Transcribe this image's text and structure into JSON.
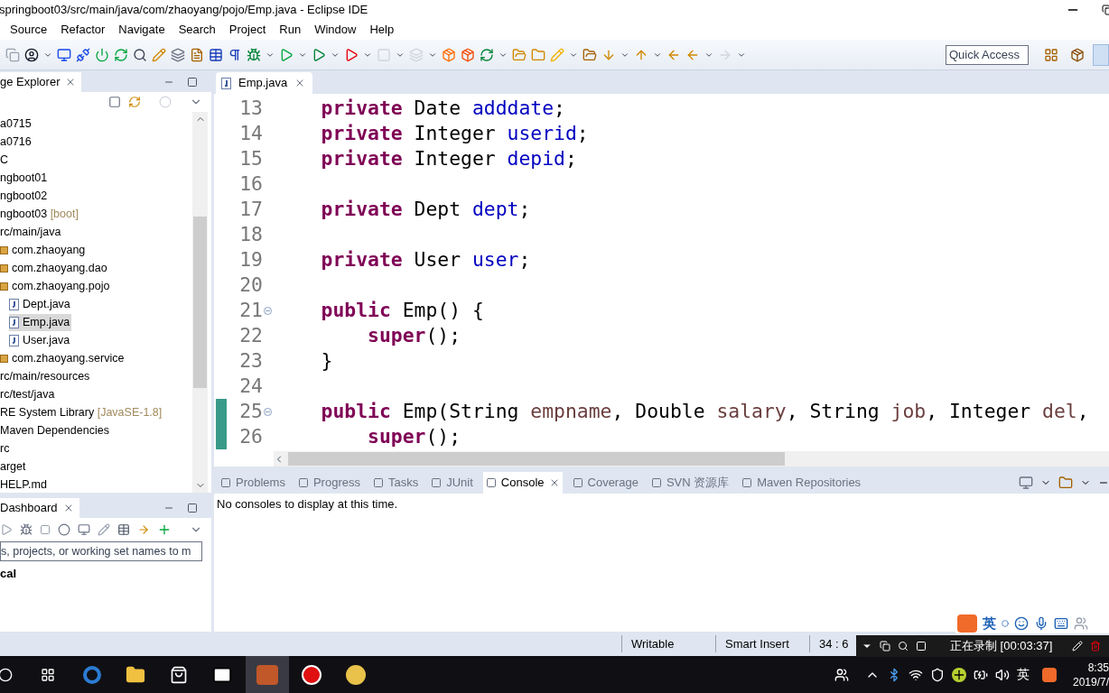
{
  "window": {
    "title": "springboot03/src/main/java/com/zhaoyang/pojo/Emp.java - Eclipse IDE"
  },
  "menu": [
    "Source",
    "Refactor",
    "Navigate",
    "Search",
    "Project",
    "Run",
    "Window",
    "Help"
  ],
  "quick_access": {
    "placeholder": "Quick Access"
  },
  "package_explorer": {
    "title": "ge Explorer",
    "items": [
      {
        "label": "a0715",
        "selected": false
      },
      {
        "label": "a0716",
        "selected": false
      },
      {
        "label": "C",
        "selected": false
      },
      {
        "label": "ngboot01",
        "selected": false
      },
      {
        "label": "ngboot02",
        "selected": false
      },
      {
        "label": "ngboot03",
        "decoration": "[boot]",
        "selected": false,
        "children": [
          {
            "label": "rc/main/java",
            "selected": false,
            "children": [
              {
                "label": "com.zhaoyang",
                "kind": "package",
                "selected": false
              },
              {
                "label": "com.zhaoyang.dao",
                "kind": "package",
                "selected": false
              },
              {
                "label": "com.zhaoyang.pojo",
                "kind": "package",
                "selected": false,
                "children": [
                  {
                    "label": "Dept.java",
                    "kind": "java",
                    "selected": false
                  },
                  {
                    "label": "Emp.java",
                    "kind": "java",
                    "selected": true
                  },
                  {
                    "label": "User.java",
                    "kind": "java",
                    "selected": false
                  }
                ]
              },
              {
                "label": "com.zhaoyang.service",
                "kind": "package",
                "selected": false
              }
            ]
          },
          {
            "label": "rc/main/resources",
            "selected": false
          },
          {
            "label": "rc/test/java",
            "selected": false
          },
          {
            "label": "RE System Library",
            "decoration": "[JavaSE-1.8]",
            "selected": false
          },
          {
            "label": "Maven Dependencies",
            "selected": false
          },
          {
            "label": "rc",
            "selected": false
          },
          {
            "label": "arget",
            "selected": false
          },
          {
            "label": "HELP.md",
            "selected": false
          }
        ]
      }
    ]
  },
  "dashboard": {
    "title": "Dashboard",
    "filter": {
      "placeholder": "s, projects, or working set names to m"
    },
    "section": "cal"
  },
  "editor": {
    "tab": "Emp.java",
    "lines": [
      {
        "number": "13",
        "tokens": [
          {
            "text": "    private",
            "kind": "keyword"
          },
          {
            "text": " Date "
          },
          {
            "text": "adddate",
            "kind": "field"
          },
          {
            "text": ";"
          }
        ]
      },
      {
        "number": "14",
        "tokens": [
          {
            "text": "    private",
            "kind": "keyword"
          },
          {
            "text": " Integer "
          },
          {
            "text": "userid",
            "kind": "field"
          },
          {
            "text": ";"
          }
        ]
      },
      {
        "number": "15",
        "tokens": [
          {
            "text": "    private",
            "kind": "keyword"
          },
          {
            "text": " Integer "
          },
          {
            "text": "depid",
            "kind": "field"
          },
          {
            "text": ";"
          }
        ]
      },
      {
        "number": "16"
      },
      {
        "number": "17",
        "tokens": [
          {
            "text": "    private",
            "kind": "keyword"
          },
          {
            "text": " Dept "
          },
          {
            "text": "dept",
            "kind": "field"
          },
          {
            "text": ";"
          }
        ]
      },
      {
        "number": "18"
      },
      {
        "number": "19",
        "tokens": [
          {
            "text": "    private",
            "kind": "keyword"
          },
          {
            "text": " User "
          },
          {
            "text": "user",
            "kind": "field"
          },
          {
            "text": ";"
          }
        ]
      },
      {
        "number": "20"
      },
      {
        "number": "21",
        "fold_marker": true,
        "tokens": [
          {
            "text": "    public",
            "kind": "keyword"
          },
          {
            "text": " Emp() {"
          }
        ]
      },
      {
        "number": "22",
        "tokens": [
          {
            "text": "        super",
            "kind": "keyword"
          },
          {
            "text": "();"
          }
        ]
      },
      {
        "number": "23",
        "tokens": [
          {
            "text": "    }"
          }
        ]
      },
      {
        "number": "24"
      },
      {
        "number": "25",
        "fold_marker": true,
        "changed": true,
        "tokens": [
          {
            "text": "    public",
            "kind": "keyword"
          },
          {
            "text": " Emp(String "
          },
          {
            "text": "empname",
            "kind": "param"
          },
          {
            "text": ", Double "
          },
          {
            "text": "salary",
            "kind": "param"
          },
          {
            "text": ", String "
          },
          {
            "text": "job",
            "kind": "param"
          },
          {
            "text": ", Integer "
          },
          {
            "text": "del",
            "kind": "param"
          },
          {
            "text": ","
          }
        ]
      },
      {
        "number": "26",
        "changed": true,
        "tokens": [
          {
            "text": "        super",
            "kind": "keyword"
          },
          {
            "text": "();"
          }
        ]
      }
    ]
  },
  "bottom_tabs": [
    {
      "label": "Problems",
      "selected": false
    },
    {
      "label": "Progress",
      "selected": false
    },
    {
      "label": "Tasks",
      "selected": false
    },
    {
      "label": "JUnit",
      "selected": false
    },
    {
      "label": "Console",
      "selected": true
    },
    {
      "label": "Coverage",
      "selected": false
    },
    {
      "label": "SVN 资源库",
      "selected": false
    },
    {
      "label": "Maven Repositories",
      "selected": false
    }
  ],
  "console_message": "No consoles to display at this time.",
  "status_bar": [
    "Writable",
    "Smart Insert",
    "34 : 6"
  ],
  "recorder": {
    "status": "正在录制 [00:03:37]"
  },
  "ime_bar": {
    "mode": "英"
  },
  "taskbar": {
    "ime": "英",
    "time": "8:35",
    "date": "2019/7/"
  }
}
